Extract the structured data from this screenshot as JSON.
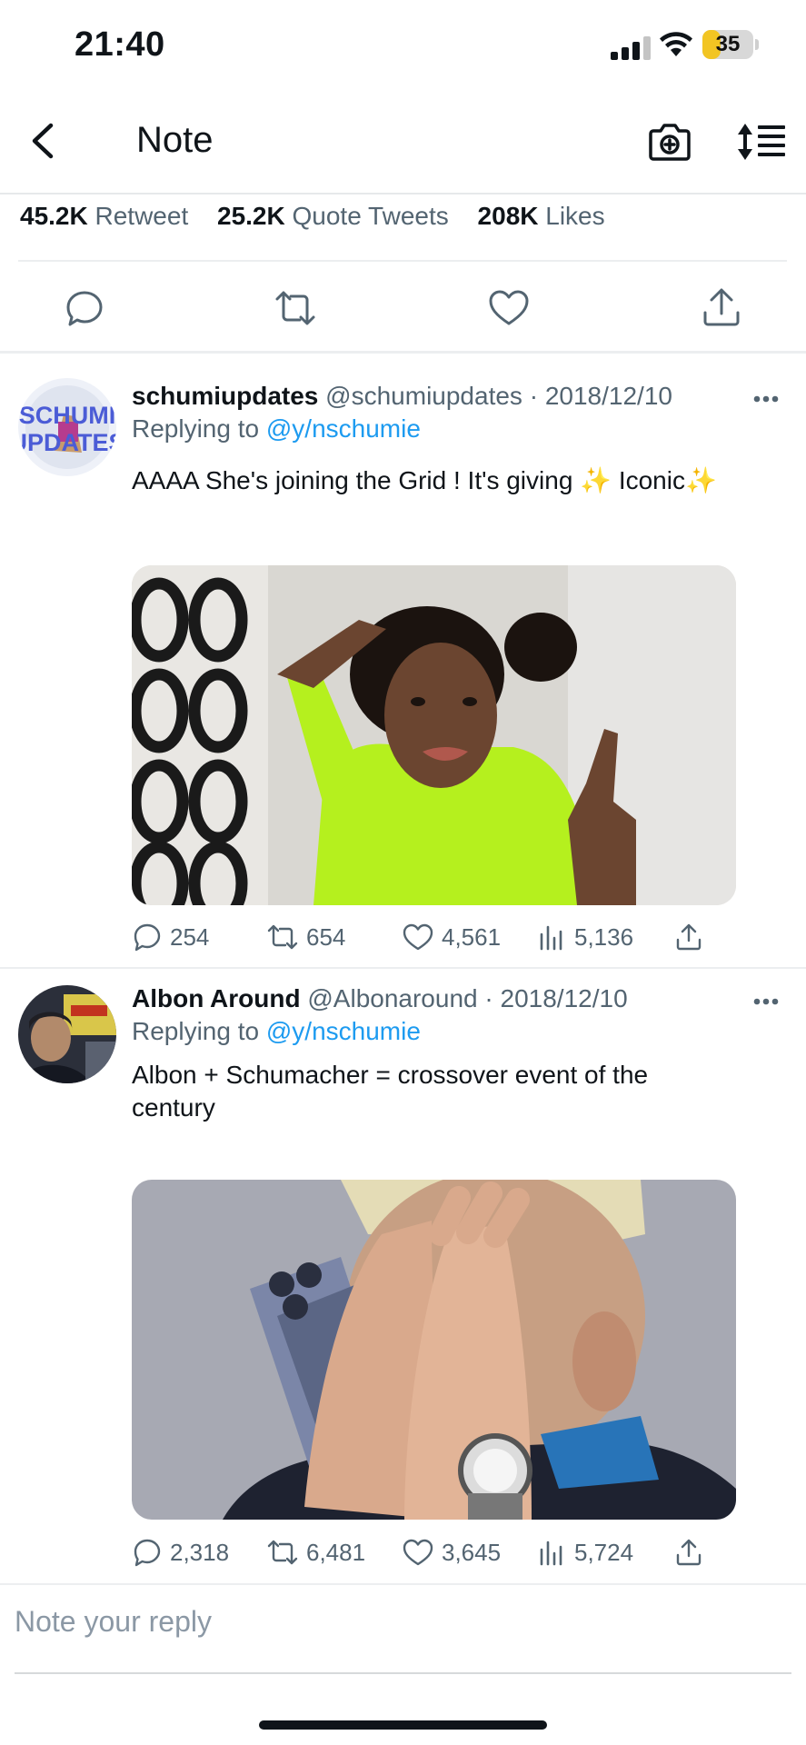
{
  "status_bar": {
    "time": "21:40",
    "battery": "35",
    "battery_fraction": 0.35,
    "battery_color": "#f2c523",
    "icons": [
      "signal-icon",
      "wifi-icon",
      "battery-icon"
    ]
  },
  "nav": {
    "title": "Note",
    "icons": [
      "back-chevron-icon",
      "camera-icon",
      "sort-icon"
    ]
  },
  "stats": {
    "retweets_count": "45.2K",
    "retweets_label": "Retweet",
    "quotes_count": "25.2K",
    "quotes_label": "Quote Tweets",
    "likes_count": "208K",
    "likes_label": "Likes"
  },
  "main_actions": [
    "reply-icon",
    "retweet-icon",
    "like-icon",
    "share-icon"
  ],
  "replies": [
    {
      "name": "schumiupdates",
      "handle": "@schumiupdates",
      "separator": "·",
      "date": "2018/12/10",
      "replying_prefix": "Replying to",
      "replying_to": "@y/nschumie",
      "text": "AAAA She's joining the Grid ! It's giving ✨ Iconic✨",
      "avatar_text": [
        "SCHUMI",
        "UPDATES"
      ],
      "reply_count": "254",
      "retweet_count": "654",
      "like_count": "4,561",
      "view_count": "5,136"
    },
    {
      "name": "Albon Around",
      "handle": "@Albonaround",
      "separator": "·",
      "date": "2018/12/10",
      "replying_prefix": "Replying to",
      "replying_to": "@y/nschumie",
      "text": "Albon + Schumacher = crossover event of the century",
      "reply_count": "2,318",
      "retweet_count": "6,481",
      "like_count": "3,645",
      "view_count": "5,724"
    }
  ],
  "reply_box": {
    "placeholder": "Note your reply"
  },
  "colors": {
    "text_primary": "#0f1419",
    "text_secondary": "#536471",
    "link": "#1d9bf0",
    "divider": "#eceef0"
  }
}
